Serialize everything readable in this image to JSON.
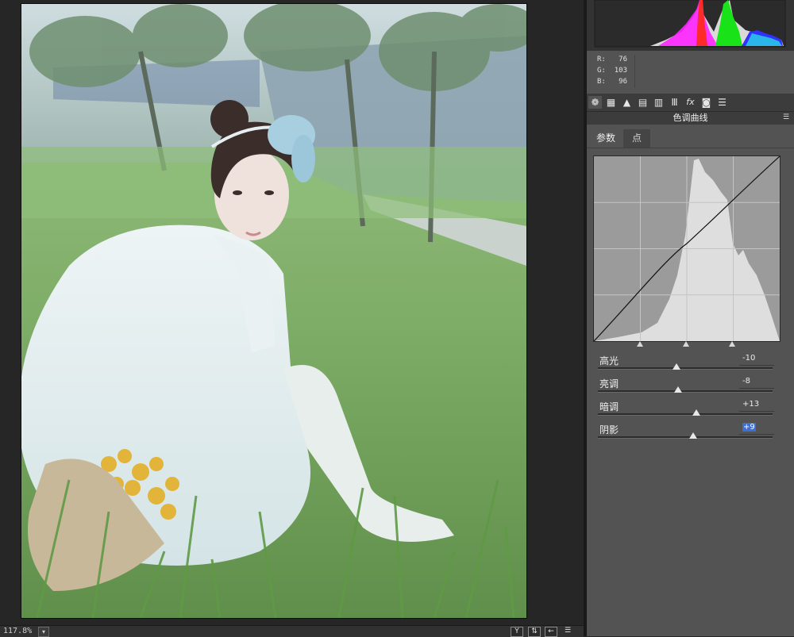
{
  "status": {
    "zoom": "117.8%",
    "zoom_dropdown_icon": "chevron-down-icon"
  },
  "rgb": {
    "r_label": "R:",
    "r": "76",
    "g_label": "G:",
    "g": "103",
    "b_label": "B:",
    "b": "96"
  },
  "tool_tabs": [
    {
      "icon": "aperture-icon",
      "glyph": "❁"
    },
    {
      "icon": "grid-icon",
      "glyph": "▦"
    },
    {
      "icon": "mountain-icon",
      "glyph": "▲"
    },
    {
      "icon": "split-tone-icon",
      "glyph": "▤"
    },
    {
      "icon": "hsl-icon",
      "glyph": "▥"
    },
    {
      "icon": "lens-icon",
      "glyph": "Ⅲ"
    },
    {
      "icon": "fx-icon",
      "glyph": "fx"
    },
    {
      "icon": "camera-icon",
      "glyph": "◙"
    },
    {
      "icon": "presets-icon",
      "glyph": "☰"
    }
  ],
  "panel": {
    "section_title": "色调曲线",
    "tab_parametric": "参数",
    "tab_point": "点"
  },
  "sliders": [
    {
      "label": "高光",
      "value": "-10",
      "level": -10
    },
    {
      "label": "亮调",
      "value": "-8",
      "level": -8
    },
    {
      "label": "暗调",
      "value": "+13",
      "level": 13
    },
    {
      "label": "阴影",
      "value": "+9",
      "level": 9
    }
  ],
  "colors": {
    "panel_bg": "#535353",
    "selection_highlight": "#3c6fd6",
    "histogram_red": "#ff2a2a",
    "histogram_green": "#19e219",
    "histogram_magenta": "#ff22ff",
    "histogram_blue": "#3030ff"
  }
}
